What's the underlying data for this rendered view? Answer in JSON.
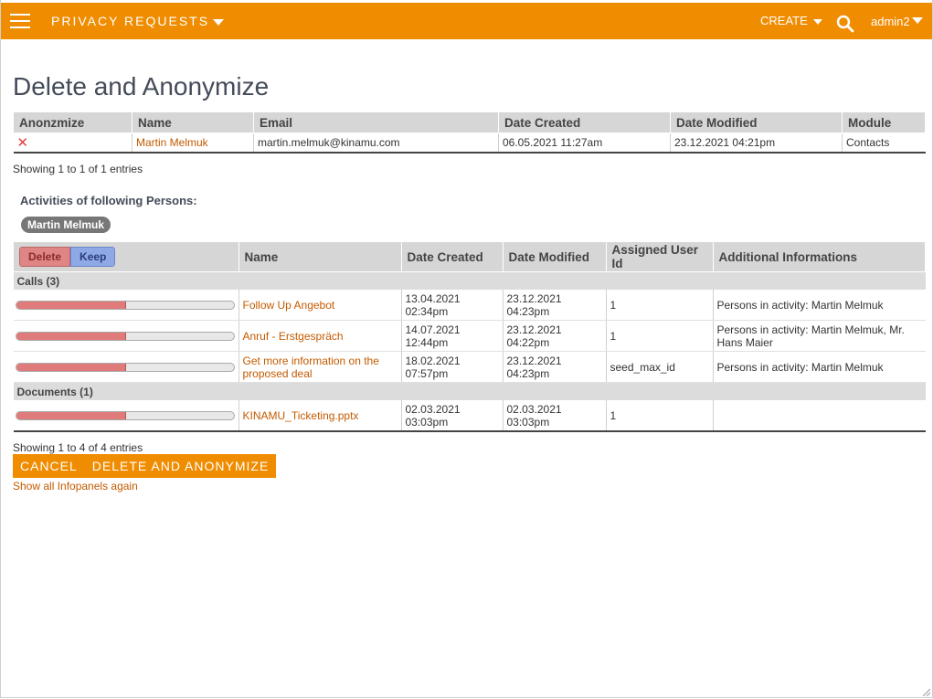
{
  "header": {
    "module_title": "PRIVACY REQUESTS",
    "create_label": "CREATE",
    "user_name": "admin2"
  },
  "page": {
    "title": "Delete and Anonymize"
  },
  "records_table": {
    "columns": [
      "Anonzmize",
      "Name",
      "Email",
      "Date Created",
      "Date Modified",
      "Module"
    ],
    "rows": [
      {
        "name": "Martin Melmuk",
        "email": "martin.melmuk@kinamu.com",
        "date_created": "06.05.2021 11:27am",
        "date_modified": "23.12.2021 04:21pm",
        "module": "Contacts"
      }
    ],
    "info": "Showing 1 to 1 of 1 entries"
  },
  "activities": {
    "label": "Activities of following Persons:",
    "persons": [
      "Martin Melmuk"
    ],
    "delete_label": "Delete",
    "keep_label": "Keep",
    "columns": [
      "Name",
      "Date Created",
      "Date Modified",
      "Assigned User Id",
      "Additional Informations"
    ],
    "groups": [
      {
        "title": "Calls (3)",
        "rows": [
          {
            "name": "Follow Up Angebot",
            "date_created": [
              "13.04.2021",
              "02:34pm"
            ],
            "date_modified": [
              "23.12.2021",
              "04:23pm"
            ],
            "assigned": "1",
            "info": "Persons in activity: Martin Melmuk",
            "delete_fraction": 0.5
          },
          {
            "name": "Anruf - Erstgespräch",
            "date_created": [
              "14.07.2021",
              "12:44pm"
            ],
            "date_modified": [
              "23.12.2021",
              "04:22pm"
            ],
            "assigned": "1",
            "info": "Persons in activity: Martin Melmuk, Mr. Hans Maier",
            "delete_fraction": 0.5
          },
          {
            "name": "Get more information on the proposed deal",
            "date_created": [
              "18.02.2021",
              "07:57pm"
            ],
            "date_modified": [
              "23.12.2021",
              "04:23pm"
            ],
            "assigned": "seed_max_id",
            "info": "Persons in activity: Martin Melmuk",
            "delete_fraction": 0.5
          }
        ]
      },
      {
        "title": "Documents (1)",
        "rows": [
          {
            "name": "KINAMU_Ticketing.pptx",
            "date_created": [
              "02.03.2021",
              "03:03pm"
            ],
            "date_modified": [
              "02.03.2021",
              "03:03pm"
            ],
            "assigned": "1",
            "info": "",
            "delete_fraction": 0.5
          }
        ]
      }
    ],
    "info": "Showing 1 to 4 of 4 entries"
  },
  "actions": {
    "cancel_label": "CANCEL",
    "delete_anonymize_label": "DELETE AND ANONYMIZE"
  },
  "footer": {
    "show_all_label": "Show all Infopanels again"
  },
  "colors": {
    "accent": "#f08c00",
    "link": "#c45a00",
    "delete": "#e07b7b",
    "keep": "#8fa8e6"
  }
}
